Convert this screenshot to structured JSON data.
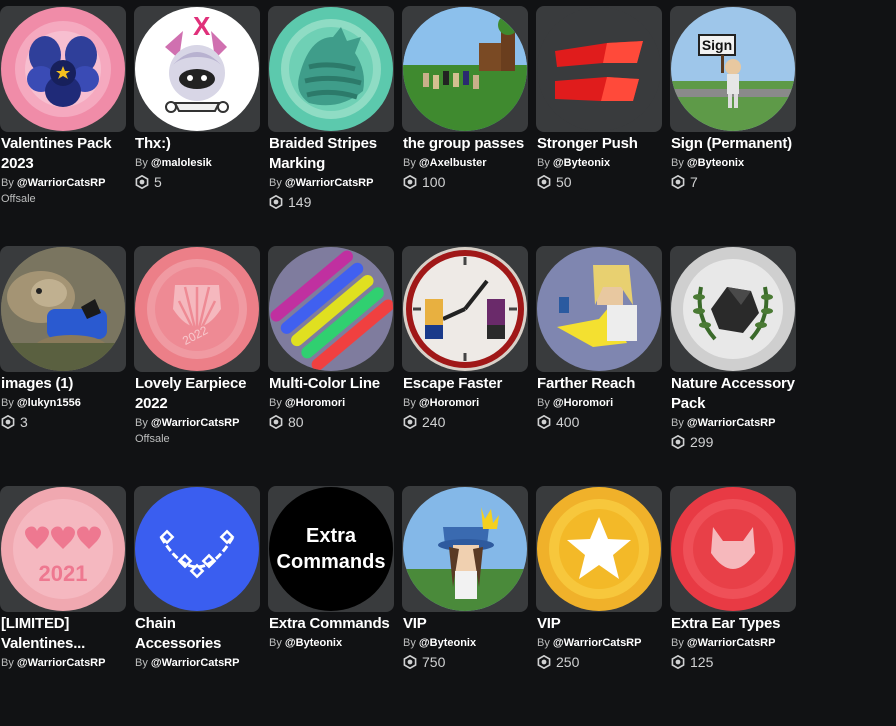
{
  "by_label": "By",
  "items": [
    {
      "name": "Valentines Pack 2023",
      "creator": "@WarriorCatsRP",
      "status": "Offsale",
      "icon": "pansy-pack-icon"
    },
    {
      "name": "Thx:)",
      "creator": "@malolesik",
      "price": "5",
      "icon": "cartoon-face-icon"
    },
    {
      "name": "Braided Stripes Marking",
      "creator": "@WarriorCatsRP",
      "price": "149",
      "icon": "striped-cat-icon"
    },
    {
      "name": "the group passes",
      "creator": "@Axelbuster",
      "price": "100",
      "icon": "group-scene-icon"
    },
    {
      "name": "Stronger Push",
      "creator": "@Byteonix",
      "price": "50",
      "icon": "push-arrows-icon"
    },
    {
      "name": "Sign (Permanent)",
      "creator": "@Byteonix",
      "price": "7",
      "icon": "sign-avatar-icon",
      "sign_text": "Sign"
    },
    {
      "name": "images (1)",
      "creator": "@lukyn1556",
      "price": "3",
      "icon": "photo-cat-icon"
    },
    {
      "name": "Lovely Earpiece 2022",
      "creator": "@WarriorCatsRP",
      "status": "Offsale",
      "icon": "heart-earpiece-icon",
      "badge_text": "2022"
    },
    {
      "name": "Multi-Color Line",
      "creator": "@Horomori",
      "price": "80",
      "icon": "color-lines-icon"
    },
    {
      "name": "Escape Faster",
      "creator": "@Horomori",
      "price": "240",
      "icon": "clock-avatars-icon"
    },
    {
      "name": "Farther Reach",
      "creator": "@Horomori",
      "price": "400",
      "icon": "reach-avatar-icon"
    },
    {
      "name": "Nature Accessory Pack",
      "creator": "@WarriorCatsRP",
      "price": "299",
      "icon": "rock-laurel-icon"
    },
    {
      "name": "[LIMITED] Valentines...",
      "creator": "@WarriorCatsRP",
      "icon": "hearts-2021-icon",
      "badge_text": "2021"
    },
    {
      "name": "Chain Accessories",
      "creator": "@WarriorCatsRP",
      "icon": "chain-icon"
    },
    {
      "name": "Extra Commands",
      "creator": "@Byteonix",
      "icon": "extra-commands-icon",
      "badge_text": "Extra Commands"
    },
    {
      "name": "VIP",
      "creator": "@Byteonix",
      "price": "750",
      "icon": "vip-avatar-icon"
    },
    {
      "name": "VIP",
      "creator": "@WarriorCatsRP",
      "price": "250",
      "icon": "gold-star-icon"
    },
    {
      "name": "Extra Ear Types",
      "creator": "@WarriorCatsRP",
      "price": "125",
      "icon": "ear-types-icon"
    }
  ]
}
